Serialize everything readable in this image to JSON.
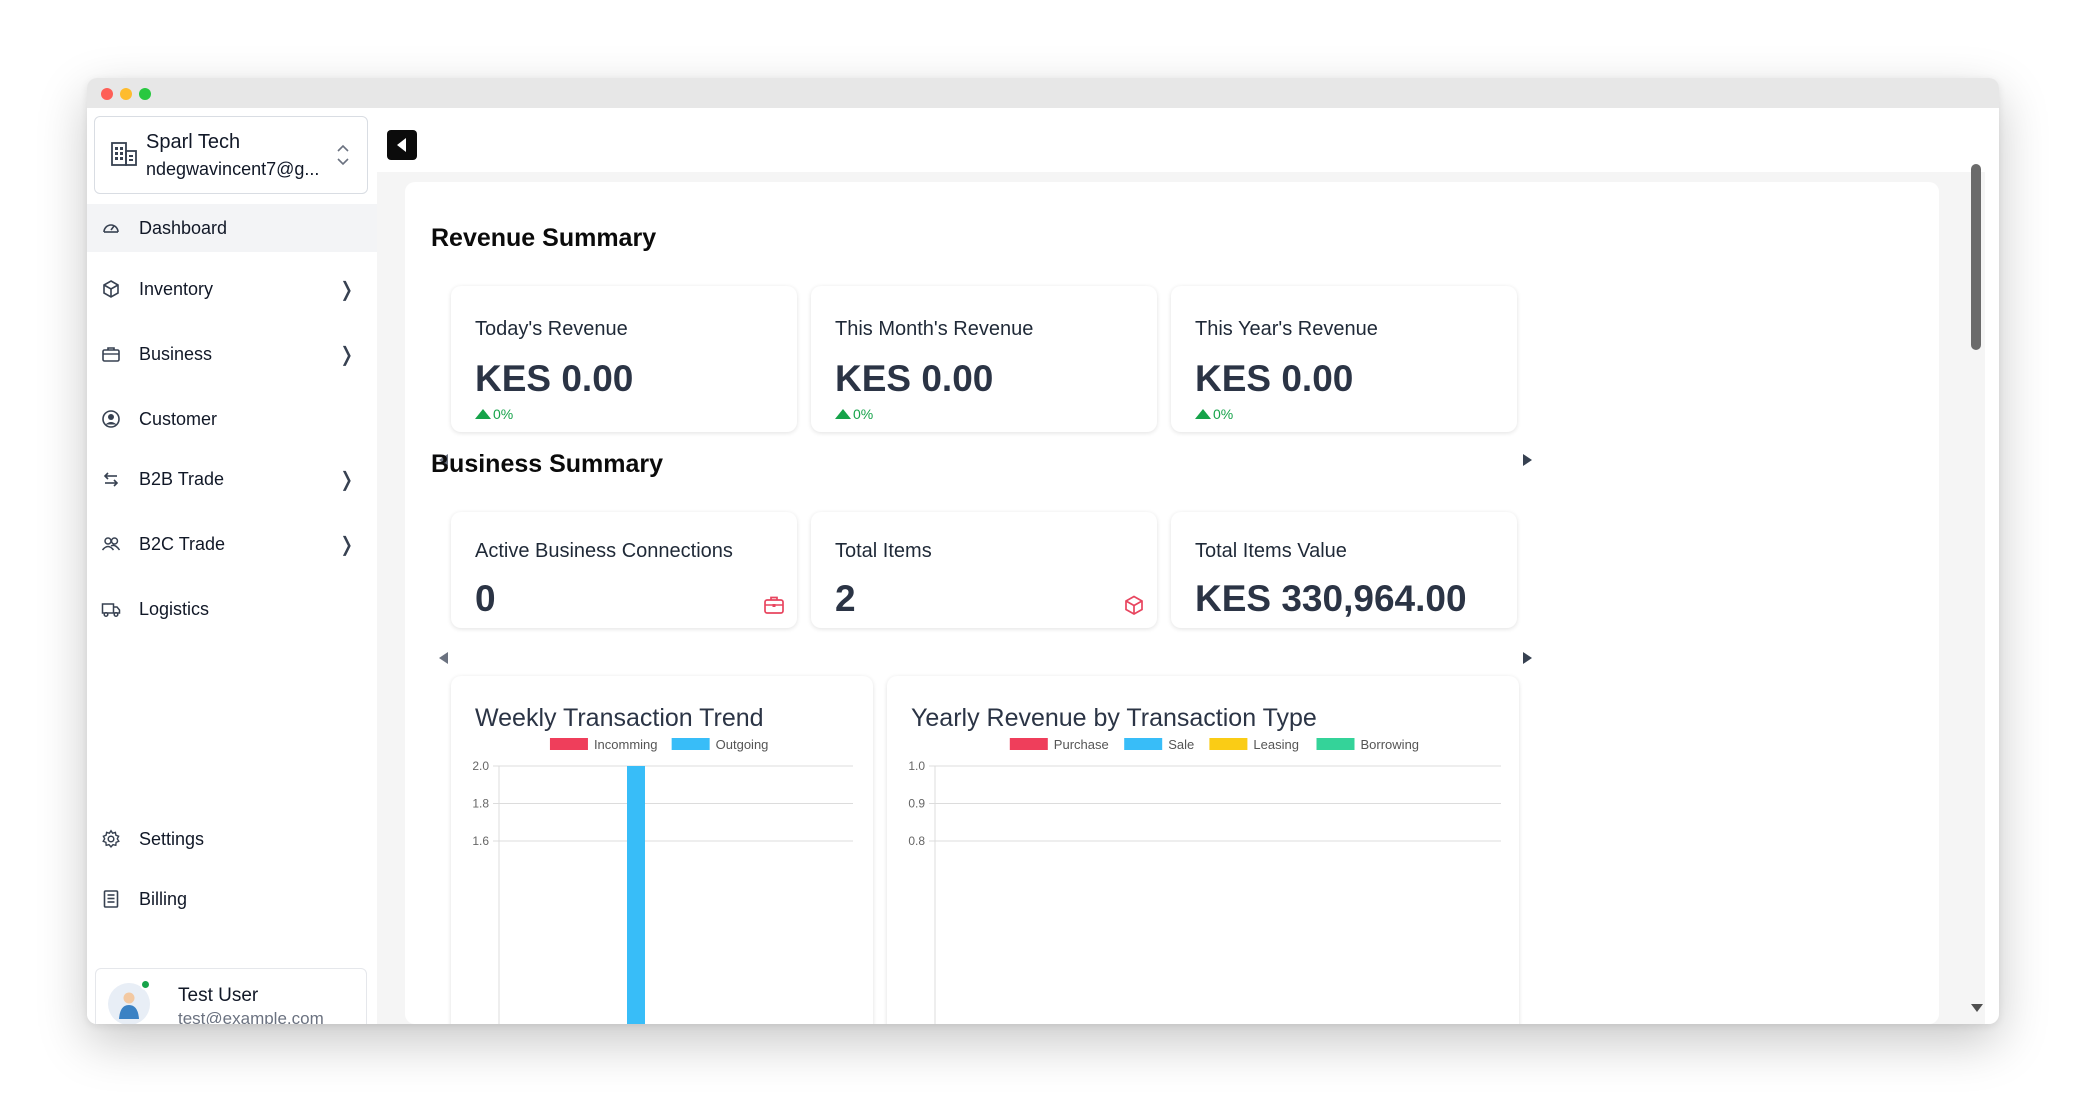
{
  "sidebar": {
    "org": {
      "name": "Sparl Tech",
      "email": "ndegwavincent7@g..."
    },
    "items": [
      {
        "label": "Dashboard",
        "icon": "gauge-icon",
        "active": true,
        "has_submenu": false
      },
      {
        "label": "Inventory",
        "icon": "box-icon",
        "has_submenu": true
      },
      {
        "label": "Business",
        "icon": "briefcase-icon",
        "has_submenu": true
      },
      {
        "label": "Customer",
        "icon": "user-circle-icon",
        "has_submenu": false
      },
      {
        "label": "B2B Trade",
        "icon": "swap-icon",
        "has_submenu": true
      },
      {
        "label": "B2C Trade",
        "icon": "users-icon",
        "has_submenu": true
      },
      {
        "label": "Logistics",
        "icon": "truck-icon",
        "has_submenu": false
      }
    ],
    "bottom_items": [
      {
        "label": "Settings",
        "icon": "gear-icon"
      },
      {
        "label": "Billing",
        "icon": "receipt-icon"
      }
    ],
    "submenu_arrow": "❭",
    "user": {
      "name": "Test User",
      "email": "test@example.com"
    }
  },
  "revenue_summary": {
    "title": "Revenue Summary",
    "cards": [
      {
        "label": "Today's Revenue",
        "value": "KES 0.00",
        "change": "0%"
      },
      {
        "label": "This Month's Revenue",
        "value": "KES 0.00",
        "change": "0%"
      },
      {
        "label": "This Year's Revenue",
        "value": "KES 0.00",
        "change": "0%"
      }
    ]
  },
  "business_summary": {
    "title": "Business Summary",
    "cards": [
      {
        "label": "Active Business Connections",
        "value": "0",
        "icon": "briefcase-icon"
      },
      {
        "label": "Total Items",
        "value": "2",
        "icon": "cube-icon"
      },
      {
        "label": "Total Items Value",
        "value": "KES 330,964.00"
      }
    ]
  },
  "colors": {
    "accent_green": "#16a34a",
    "icon_red": "#e8455f",
    "value_text": "#2b3445",
    "purchase": "#ef3e5b",
    "sale": "#38bdf8",
    "leasing": "#facc15",
    "borrowing": "#34d399"
  },
  "chart_data": [
    {
      "type": "bar",
      "title": "Weekly Transaction Trend",
      "series": [
        {
          "name": "Incomming",
          "color": "#ef3e5b",
          "values": [
            0
          ]
        },
        {
          "name": "Outgoing",
          "color": "#38bdf8",
          "values": [
            2
          ]
        }
      ],
      "y_ticks": [
        "2.0",
        "1.8",
        "1.6"
      ],
      "ylim_visible": [
        1.6,
        2.0
      ],
      "legend": "top-center",
      "grid": true
    },
    {
      "type": "bar",
      "title": "Yearly Revenue by Transaction Type",
      "series": [
        {
          "name": "Purchase",
          "color": "#ef3e5b",
          "values": []
        },
        {
          "name": "Sale",
          "color": "#38bdf8",
          "values": []
        },
        {
          "name": "Leasing",
          "color": "#facc15",
          "values": []
        },
        {
          "name": "Borrowing",
          "color": "#34d399",
          "values": []
        }
      ],
      "y_ticks": [
        "1.0",
        "0.9",
        "0.8"
      ],
      "ylim_visible": [
        0.8,
        1.0
      ],
      "legend": "top-center",
      "grid": true
    }
  ]
}
